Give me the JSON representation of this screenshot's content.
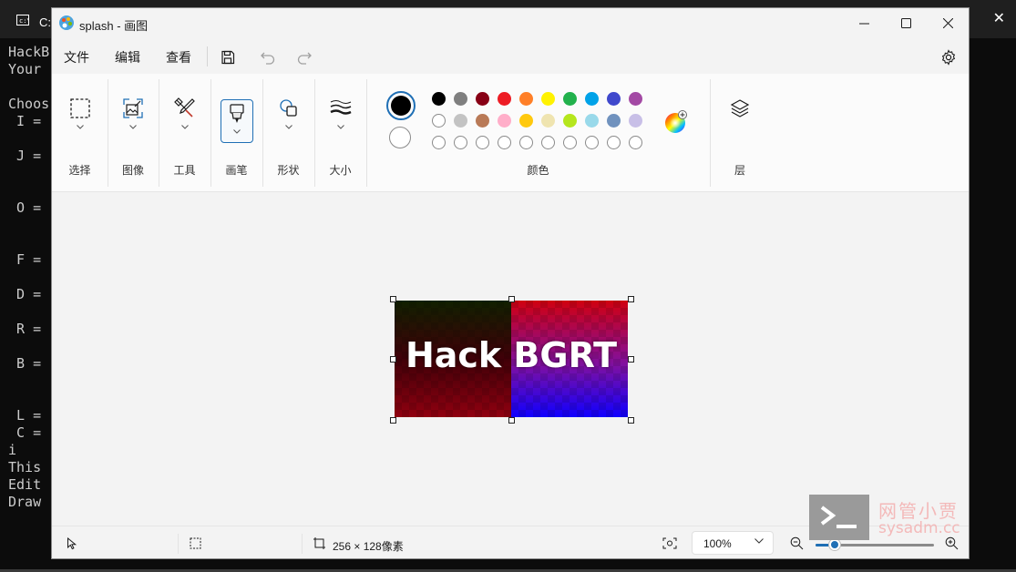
{
  "terminal": {
    "title_fragment": "C:",
    "lines": "HackB\nYour \n\nChoos\n I = \n\n J = \n\n\n O = \n\n\n F = \n\n D = \n\n R = \n\n B = \n\n\n L = \n C = \ni\nThis \nEdit \nDraw "
  },
  "window": {
    "title": "splash - 画图",
    "buttons": {
      "minimize": "minimize-icon",
      "maximize": "maximize-icon",
      "close": "close-icon"
    }
  },
  "menu": {
    "file": "文件",
    "edit": "编辑",
    "view": "查看"
  },
  "ribbon": {
    "groups": {
      "selection": "选择",
      "image": "图像",
      "tools": "工具",
      "brushes": "画笔",
      "shapes": "形状",
      "size": "大小",
      "colors": "颜色",
      "layers": "层"
    },
    "primary_color": "#000000",
    "secondary_color": "#ffffff",
    "palette_row1": [
      "#000000",
      "#7f7f7f",
      "#880015",
      "#ed1c24",
      "#ff7f27",
      "#fff200",
      "#22b14c",
      "#00a2e8",
      "#3f48cc",
      "#a349a4"
    ],
    "palette_row2": [
      "#ffffff",
      "#c3c3c3",
      "#b97a57",
      "#ffaec9",
      "#ffc90e",
      "#efe4b0",
      "#b5e61d",
      "#99d9ea",
      "#7092be",
      "#c8bfe7"
    ],
    "palette_row3_count": 10
  },
  "canvas": {
    "image_text": "Hack BGRT"
  },
  "status": {
    "size": "256 × 128像素",
    "zoom": "100%",
    "zoom_fraction": 0.16
  },
  "watermark": {
    "title": "网管小贾",
    "url": "sysadm.cc"
  }
}
